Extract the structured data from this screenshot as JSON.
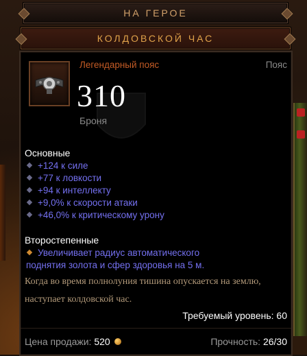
{
  "header": {
    "tab_label": "НА ГЕРОЕ",
    "item_title": "КОЛДОВСКОЙ ЧАС"
  },
  "item": {
    "rarity_type": "Легендарный пояс",
    "slot": "Пояс",
    "armor_value": "310",
    "armor_label": "Броня",
    "icon": "belt-icon",
    "colors": {
      "legendary": "#c45b25",
      "affix": "#7470f0",
      "flavor": "#b39a7a"
    }
  },
  "primary": {
    "title": "Основные",
    "stats": [
      "+124 к силе",
      "+77 к ловкости",
      "+94 к интеллекту",
      "+9,0% к скорости атаки",
      "+46,0% к критическому урону"
    ]
  },
  "secondary": {
    "title": "Второстепенные",
    "stat": "Увеличивает радиус автоматического поднятия золота и сфер здоровья на 5 м."
  },
  "flavor_text": "Когда во время полнолуния тишина опускается на землю, наступает колдовской час.",
  "required_level": "Требуемый уровень: 60",
  "footer": {
    "sell_label": "Цена продажи:",
    "sell_value": "520",
    "durability_label": "Прочность:",
    "durability_value": "26/30"
  }
}
